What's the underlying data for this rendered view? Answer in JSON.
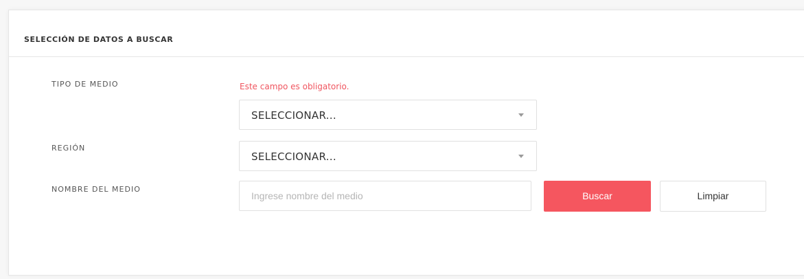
{
  "panel": {
    "title": "SELECCIÓN DE DATOS A BUSCAR"
  },
  "form": {
    "tipo_medio": {
      "label": "TIPO DE MEDIO",
      "error": "Este campo es obligatorio.",
      "value": "SELECCIONAR...",
      "icon": "chevron-down-icon"
    },
    "region": {
      "label": "REGIÓN",
      "value": "SELECCIONAR...",
      "icon": "chevron-down-icon"
    },
    "nombre_medio": {
      "label": "NOMBRE DEL MEDIO",
      "placeholder": "Ingrese nombre del medio",
      "value": ""
    }
  },
  "actions": {
    "search_label": "Buscar",
    "clear_label": "Limpiar"
  },
  "colors": {
    "accent": "#f5565f",
    "error": "#f0555f"
  }
}
